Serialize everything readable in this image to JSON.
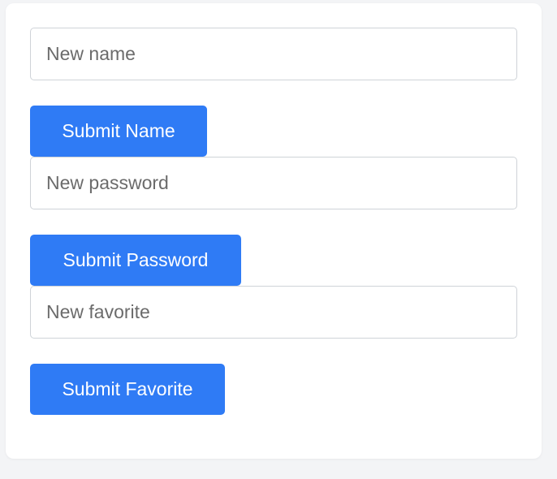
{
  "name_form": {
    "placeholder": "New name",
    "value": "",
    "submit_label": "Submit Name"
  },
  "password_form": {
    "placeholder": "New password",
    "value": "",
    "submit_label": "Submit Password"
  },
  "favorite_form": {
    "placeholder": "New favorite",
    "value": "",
    "submit_label": "Submit Favorite"
  },
  "colors": {
    "button_background": "#2f7bf5",
    "button_text": "#ffffff",
    "page_background": "#f3f4f6",
    "card_background": "#ffffff",
    "input_border": "#cfd3d8"
  }
}
